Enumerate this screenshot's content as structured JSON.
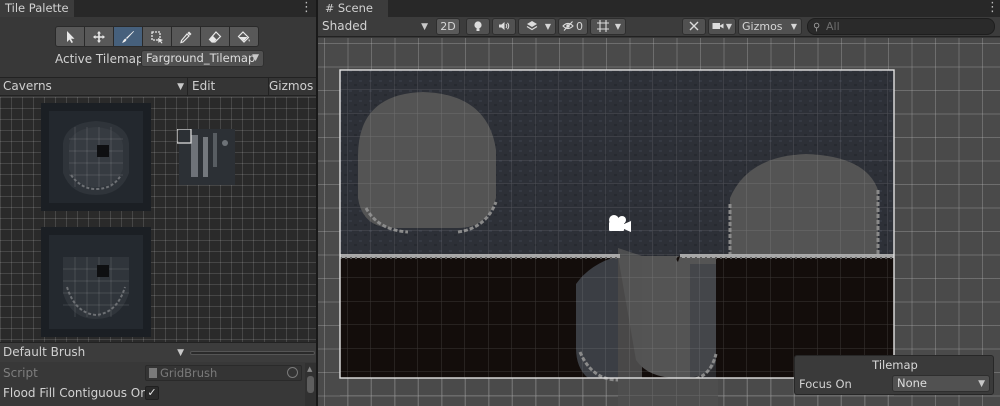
{
  "palette_panel": {
    "tab_title": "Tile Palette",
    "tools": [
      {
        "name": "select",
        "active": false
      },
      {
        "name": "move",
        "active": false
      },
      {
        "name": "paint-brush",
        "active": true
      },
      {
        "name": "box-fill",
        "active": false
      },
      {
        "name": "picker",
        "active": false
      },
      {
        "name": "eraser",
        "active": false
      },
      {
        "name": "flood-fill",
        "active": false
      }
    ],
    "active_tilemap_label": "Active Tilemap",
    "active_tilemap_value": "Farground_Tilemap",
    "palette_name": "Caverns",
    "edit_label": "Edit",
    "gizmos_label": "Gizmos",
    "brush_name": "Default Brush",
    "script_label": "Script",
    "script_value": "GridBrush",
    "flood_fill_label": "Flood Fill Contiguous Only",
    "flood_fill_checked": true,
    "flood_fill_check_glyph": "✓"
  },
  "scene_panel": {
    "tab_title": "Scene",
    "shading_mode": "Shaded",
    "mode_2d_label": "2D",
    "hidden_count": "0",
    "gizmos_label": "Gizmos",
    "search_placeholder": "All",
    "overlay_title": "Tilemap",
    "focus_on_label": "Focus On",
    "focus_on_value": "None"
  },
  "colors": {
    "selection_blue": "#46607c",
    "cave_rock": "#2d3037",
    "cave_dark_floor": "#130d0b",
    "cave_opening": "#545454"
  }
}
